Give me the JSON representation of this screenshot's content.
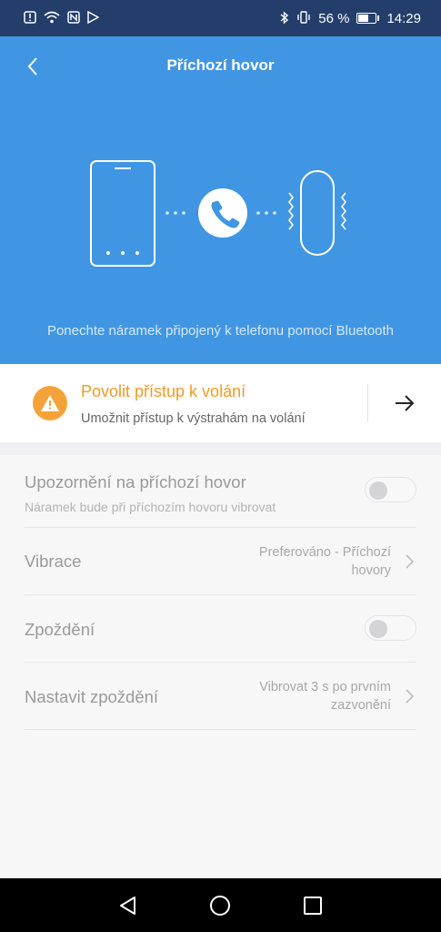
{
  "status_bar": {
    "battery_percent": "56 %",
    "time": "14:29",
    "left_icons": [
      "alert-icon",
      "wifi-icon",
      "nfc-icon",
      "play-store-icon"
    ],
    "right_icons": [
      "bluetooth-icon",
      "vibrate-icon",
      "battery-icon"
    ]
  },
  "header": {
    "title": "Příchozí hovor",
    "subtitle": "Ponechte náramek připojený k telefonu pomocí Bluetooth"
  },
  "permission": {
    "title": "Povolit přístup k volání",
    "subtitle": "Umožnit přístup k výstrahám na volání"
  },
  "settings": {
    "incoming_call": {
      "label": "Upozornění na příchozí hovor",
      "sub": "Náramek bude při příchozím hovoru vibrovat",
      "enabled": false
    },
    "vibration": {
      "label": "Vibrace",
      "value_line1": "Preferováno - Příchozí",
      "value_line2": "hovory"
    },
    "delay": {
      "label": "Zpoždění",
      "enabled": false
    },
    "set_delay": {
      "label": "Nastavit zpoždění",
      "value_line1": "Vibrovat 3 s po prvním",
      "value_line2": "zazvonění"
    }
  },
  "colors": {
    "status_bar": "#233e6a",
    "hero": "#4096e3",
    "warning": "#f19a26"
  }
}
